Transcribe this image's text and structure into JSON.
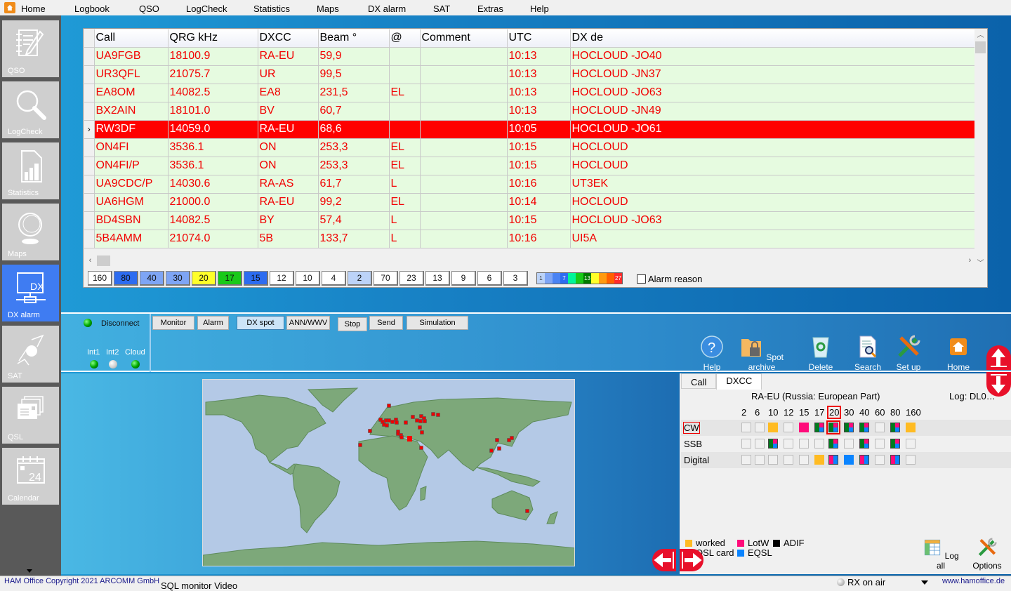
{
  "menu": {
    "items": [
      "Home",
      "Logbook",
      "QSO",
      "LogCheck",
      "Statistics",
      "Maps",
      "DX alarm",
      "SAT",
      "Extras",
      "Help"
    ]
  },
  "sidebar": {
    "items": [
      {
        "label": "QSO",
        "icon": "notebook-pen-icon"
      },
      {
        "label": "LogCheck",
        "icon": "magnifier-icon"
      },
      {
        "label": "Statistics",
        "icon": "bar-chart-document-icon"
      },
      {
        "label": "Maps",
        "icon": "globe-icon"
      },
      {
        "label": "DX alarm",
        "icon": "dx-network-icon",
        "active": true
      },
      {
        "label": "SAT",
        "icon": "satellite-icon"
      },
      {
        "label": "QSL",
        "icon": "qsl-cards-icon"
      },
      {
        "label": "Calendar",
        "icon": "calendar-icon",
        "day": "24"
      }
    ]
  },
  "spots": {
    "columns": [
      "Call",
      "QRG kHz",
      "DXCC",
      "Beam °",
      "@",
      "Comment",
      "UTC",
      "DX de"
    ],
    "rows": [
      {
        "call": "UA9FGB",
        "qrg": "18100.9",
        "dxcc": "RA-EU",
        "beam": "59,9",
        "at": "",
        "comment": "",
        "utc": "10:13",
        "dxde": "HOCLOUD -JO40"
      },
      {
        "call": "UR3QFL",
        "qrg": "21075.7",
        "dxcc": "UR",
        "beam": "99,5",
        "at": "",
        "comment": "",
        "utc": "10:13",
        "dxde": "HOCLOUD -JN37"
      },
      {
        "call": "EA8OM",
        "qrg": "14082.5",
        "dxcc": "EA8",
        "beam": "231,5",
        "at": "EL",
        "comment": "",
        "utc": "10:13",
        "dxde": "HOCLOUD -JO63"
      },
      {
        "call": "BX2AIN",
        "qrg": "18101.0",
        "dxcc": "BV",
        "beam": "60,7",
        "at": "",
        "comment": "",
        "utc": "10:13",
        "dxde": "HOCLOUD -JN49"
      },
      {
        "call": "RW3DF",
        "qrg": "14059.0",
        "dxcc": "RA-EU",
        "beam": "68,6",
        "at": "",
        "comment": "",
        "utc": "10:05",
        "dxde": "HOCLOUD -JO61",
        "selected": true
      },
      {
        "call": "ON4FI",
        "qrg": "3536.1",
        "dxcc": "ON",
        "beam": "253,3",
        "at": "EL",
        "comment": "",
        "utc": "10:15",
        "dxde": "HOCLOUD"
      },
      {
        "call": "ON4FI/P",
        "qrg": "3536.1",
        "dxcc": "ON",
        "beam": "253,3",
        "at": "EL",
        "comment": "",
        "utc": "10:15",
        "dxde": "HOCLOUD"
      },
      {
        "call": "UA9CDC/P",
        "qrg": "14030.6",
        "dxcc": "RA-AS",
        "beam": "61,7",
        "at": " L",
        "comment": "",
        "utc": "10:16",
        "dxde": "UT3EK"
      },
      {
        "call": "UA6HGM",
        "qrg": "21000.0",
        "dxcc": "RA-EU",
        "beam": "99,2",
        "at": "EL",
        "comment": "",
        "utc": "10:14",
        "dxde": "HOCLOUD"
      },
      {
        "call": "BD4SBN",
        "qrg": "14082.5",
        "dxcc": "BY",
        "beam": "57,4",
        "at": " L",
        "comment": "",
        "utc": "10:15",
        "dxde": "HOCLOUD -JO63"
      },
      {
        "call": "5B4AMM",
        "qrg": "21074.0",
        "dxcc": "5B",
        "beam": "133,7",
        "at": " L",
        "comment": "",
        "utc": "10:16",
        "dxde": "UI5A"
      }
    ],
    "selected_marker": "›"
  },
  "band_filter": [
    {
      "label": "160",
      "color": "#ffffff"
    },
    {
      "label": "80",
      "color": "#2d6cf0"
    },
    {
      "label": "40",
      "color": "#7ea5f5"
    },
    {
      "label": "30",
      "color": "#7ea5f5"
    },
    {
      "label": "20",
      "color": "#ffff2a"
    },
    {
      "label": "17",
      "color": "#19c919"
    },
    {
      "label": "15",
      "color": "#2d6cf0"
    },
    {
      "label": "12",
      "color": "#ffffff"
    },
    {
      "label": "10",
      "color": "#ffffff"
    },
    {
      "label": "4",
      "color": "#ffffff"
    },
    {
      "label": "2",
      "color": "#bcd3f8"
    },
    {
      "label": "70",
      "color": "#ffffff"
    },
    {
      "label": "23",
      "color": "#ffffff"
    },
    {
      "label": "13",
      "color": "#ffffff"
    },
    {
      "label": "9",
      "color": "#ffffff"
    },
    {
      "label": "6",
      "color": "#ffffff"
    },
    {
      "label": "3",
      "color": "#ffffff"
    }
  ],
  "count_scale": {
    "colors": [
      "#bcd3f8",
      "#7ea5f5",
      "#4a83f3",
      "#2d6cf0",
      "#00f59a",
      "#19c919",
      "#007a00",
      "#ffff2a",
      "#ff9a0f",
      "#ff6000",
      "#ff2b2b"
    ],
    "labels": [
      "1",
      "",
      "",
      "7",
      "",
      "",
      "13",
      "",
      "",
      "",
      "27"
    ]
  },
  "alarm_reason": {
    "label": "Alarm reason",
    "checked": false
  },
  "connection": {
    "status_label": "Disconnect",
    "indicators": [
      {
        "label": "Int1",
        "on": true
      },
      {
        "label": "Int2",
        "on": false
      },
      {
        "label": "Cloud",
        "on": true
      }
    ]
  },
  "cluster_buttons": [
    "Monitor",
    "Alarm",
    "DX spot",
    "ANN/WWV",
    "Stop",
    "Send",
    "Simulation"
  ],
  "cluster_active": "DX spot",
  "tools": [
    {
      "label": "Help",
      "icon": "help-icon"
    },
    {
      "label": "Spot archive",
      "icon": "locked-folder-icon"
    },
    {
      "label": "Delete",
      "icon": "recycle-bin-icon"
    },
    {
      "label": "Search",
      "icon": "document-search-icon"
    },
    {
      "label": "Set up",
      "icon": "tools-icon"
    },
    {
      "label": "Home",
      "icon": "home-icon"
    }
  ],
  "dxcc_panel": {
    "tabs": [
      "Call",
      "DXCC"
    ],
    "active_tab": "DXCC",
    "entity": "RA-EU (Russia: European Part)",
    "log": "Log: DL0…",
    "bands": [
      "2",
      "6",
      "10",
      "12",
      "15",
      "17",
      "20",
      "30",
      "40",
      "60",
      "80",
      "160"
    ],
    "highlight_band": "20",
    "modes": [
      {
        "label": "CW",
        "highlight": true,
        "cells": [
          "",
          "",
          "worked",
          "",
          "lotw",
          "full",
          "full",
          "full",
          "full",
          "",
          "full",
          "worked"
        ]
      },
      {
        "label": "SSB",
        "cells": [
          "",
          "",
          "full",
          "",
          "",
          "",
          "full",
          "",
          "full",
          "",
          "full",
          ""
        ]
      },
      {
        "label": "Digital",
        "cells": [
          "",
          "",
          "",
          "",
          "",
          "worked",
          "lotw-eqsl",
          "eqsl",
          "lotw-eqsl",
          "",
          "lotw-eqsl",
          ""
        ]
      }
    ],
    "legend": [
      {
        "label": "worked",
        "color": "#ffbb22"
      },
      {
        "label": "LotW",
        "color": "#ff0a7a"
      },
      {
        "label": "ADIF",
        "color": "#000000"
      },
      {
        "label": "QSL card",
        "color": "#007a1e"
      },
      {
        "label": "EQSL",
        "color": "#0a84ff"
      }
    ],
    "actions": [
      {
        "label": "Log all",
        "icon": "spreadsheet-icon"
      },
      {
        "label": "Options",
        "icon": "tools-icon"
      }
    ]
  },
  "map": {
    "spots_count": 38
  },
  "status": {
    "copyright": "HAM Office Copyright 2021 ARCOMM GmbH",
    "links": "SQL monitor   Video",
    "rx": "RX on air",
    "url": "www.hamoffice.de"
  }
}
